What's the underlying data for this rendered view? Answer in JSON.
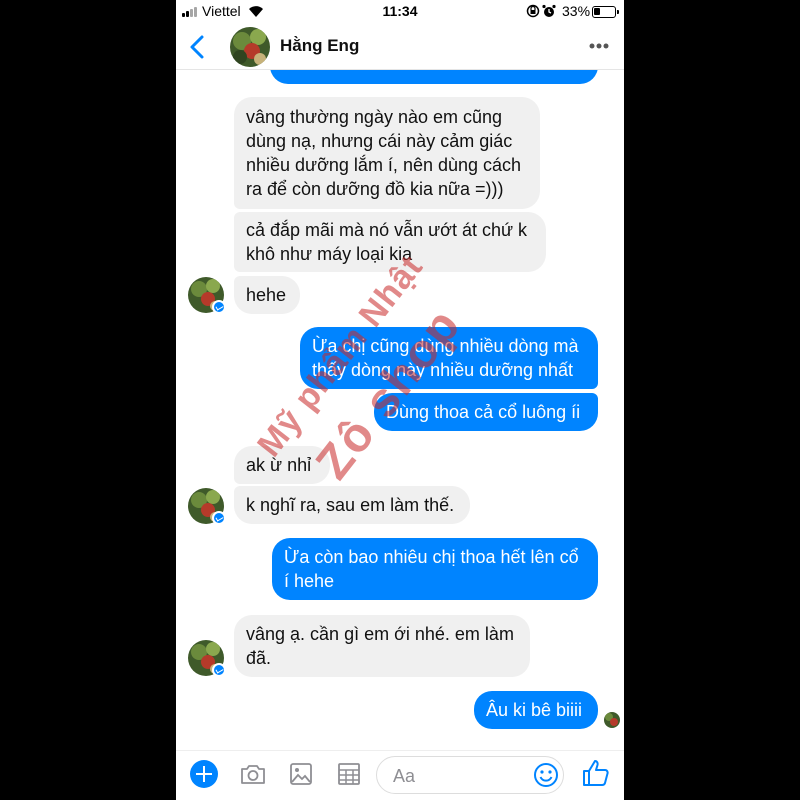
{
  "status_bar": {
    "carrier": "Viettel",
    "time": "11:34",
    "battery_percent": "33%",
    "battery_level": 0.33
  },
  "header": {
    "contact_name": "Hằng Eng",
    "back_icon": "chevron-left-icon",
    "more_icon": "more-dots-icon"
  },
  "messages": [
    {
      "from": "me",
      "text": ""
    },
    {
      "from": "them",
      "text": "vâng thường  ngày nào em cũng\ndùng nạ, nhưng cái này cảm giác\nnhiều dưỡng lắm í, nên dùng cách\nra để còn dưỡng đồ kia nữa =)))"
    },
    {
      "from": "them",
      "text": "cả đắp mãi mà nó vẫn ướt át chứ k\nkhô như máy loại kia"
    },
    {
      "from": "them",
      "text": "hehe"
    },
    {
      "from": "me",
      "text": "Ừa chị cũng dùng nhiều dòng mà\nthấy dòng này nhiều dưỡng nhất"
    },
    {
      "from": "me",
      "text": "Dùng thoa cả cổ luông íi"
    },
    {
      "from": "them",
      "text": "ak ừ nhỉ"
    },
    {
      "from": "them",
      "text": "k nghĩ ra, sau em làm thế."
    },
    {
      "from": "me",
      "text": "Ừa còn bao nhiêu chị thoa hết lên cổ\ní hehe"
    },
    {
      "from": "them",
      "text": "vâng ạ. cần gì em ới nhé. em làm\nđã."
    },
    {
      "from": "me",
      "text": "Âu ki bê biiii"
    }
  ],
  "watermark": {
    "line1": "Mỹ phẩm Nhật",
    "line2": "Zô shop"
  },
  "composer": {
    "placeholder": "Aa",
    "icons": [
      "plus-icon",
      "camera-icon",
      "image-icon",
      "grid-icon",
      "emoji-icon",
      "thumbs-up-icon"
    ]
  },
  "colors": {
    "sent_bubble": "#0084ff",
    "received_bubble": "#f0f0f0",
    "accent": "#0084ff"
  }
}
